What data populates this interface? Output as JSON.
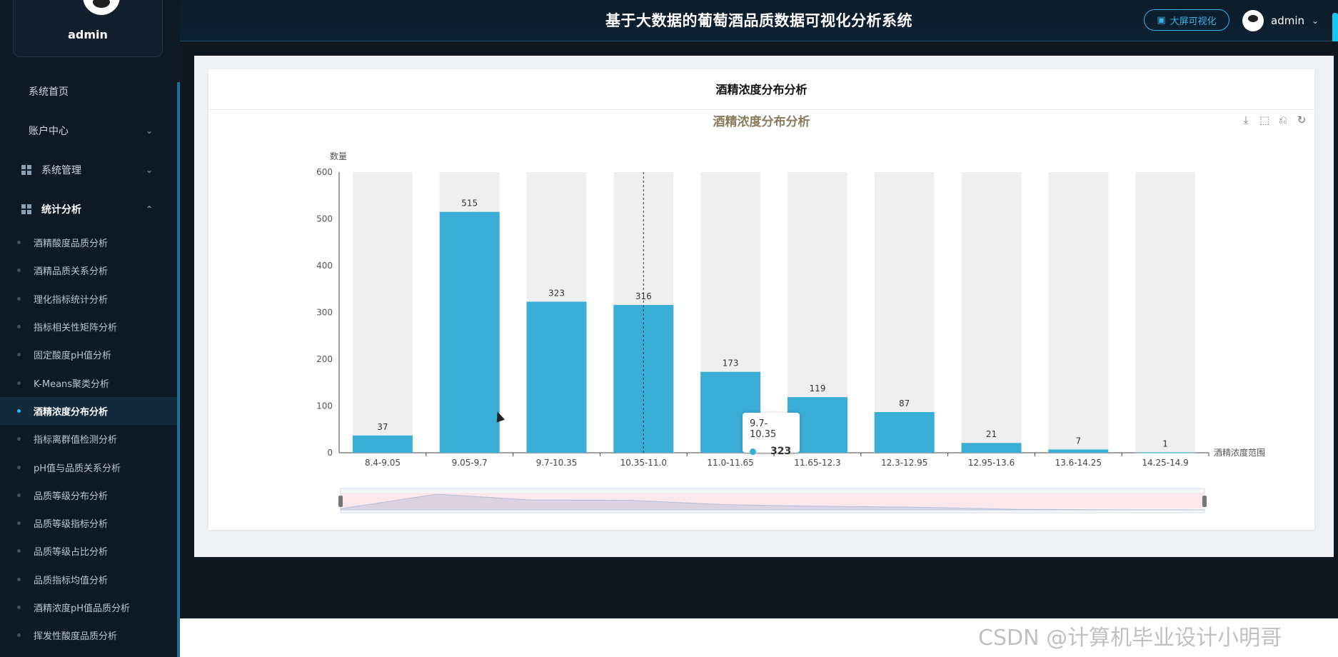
{
  "sidebar": {
    "user": {
      "name": "admin"
    },
    "menu": [
      {
        "label": "系统首页"
      },
      {
        "label": "账户中心"
      },
      {
        "label": "系统管理"
      },
      {
        "label": "统计分析"
      }
    ],
    "submenu": [
      {
        "label": "酒精酸度品质分析"
      },
      {
        "label": "酒精品质关系分析"
      },
      {
        "label": "理化指标统计分析"
      },
      {
        "label": "指标相关性矩阵分析"
      },
      {
        "label": "固定酸度pH值分析"
      },
      {
        "label": "K-Means聚类分析"
      },
      {
        "label": "酒精浓度分布分析"
      },
      {
        "label": "指标离群值检测分析"
      },
      {
        "label": "pH值与品质关系分析"
      },
      {
        "label": "品质等级分布分析"
      },
      {
        "label": "品质等级指标分析"
      },
      {
        "label": "品质等级占比分析"
      },
      {
        "label": "品质指标均值分析"
      },
      {
        "label": "酒精浓度pH值品质分析"
      },
      {
        "label": "挥发性酸度品质分析"
      }
    ],
    "active_submenu": "酒精浓度分布分析"
  },
  "header": {
    "title": "基于大数据的葡萄酒品质数据可视化分析系统",
    "bigscreen_label": "大屏可视化",
    "user_name": "admin"
  },
  "card": {
    "title": "酒精浓度分布分析"
  },
  "tooltip": {
    "category": "9.7-10.35",
    "value": "323"
  },
  "watermark": "CSDN @计算机毕业设计小明哥",
  "colors": {
    "bar": "#3aaed6",
    "bar_background": "#efefef",
    "accent": "#29b7f5"
  },
  "chart_data": {
    "type": "bar",
    "title": "酒精浓度分布分析",
    "xlabel": "酒精浓度范围",
    "ylabel": "数量",
    "ylim": [
      0,
      600
    ],
    "yticks": [
      0,
      100,
      200,
      300,
      400,
      500,
      600
    ],
    "categories": [
      "8.4-9.05",
      "9.05-9.7",
      "9.7-10.35",
      "10.35-11.0",
      "11.0-11.65",
      "11.65-12.3",
      "12.3-12.95",
      "12.95-13.6",
      "13.6-14.25",
      "14.25-14.9"
    ],
    "values": [
      37,
      515,
      323,
      316,
      173,
      119,
      87,
      21,
      7,
      1
    ],
    "data_labels": true,
    "background_bars": true,
    "data_zoom": true
  }
}
